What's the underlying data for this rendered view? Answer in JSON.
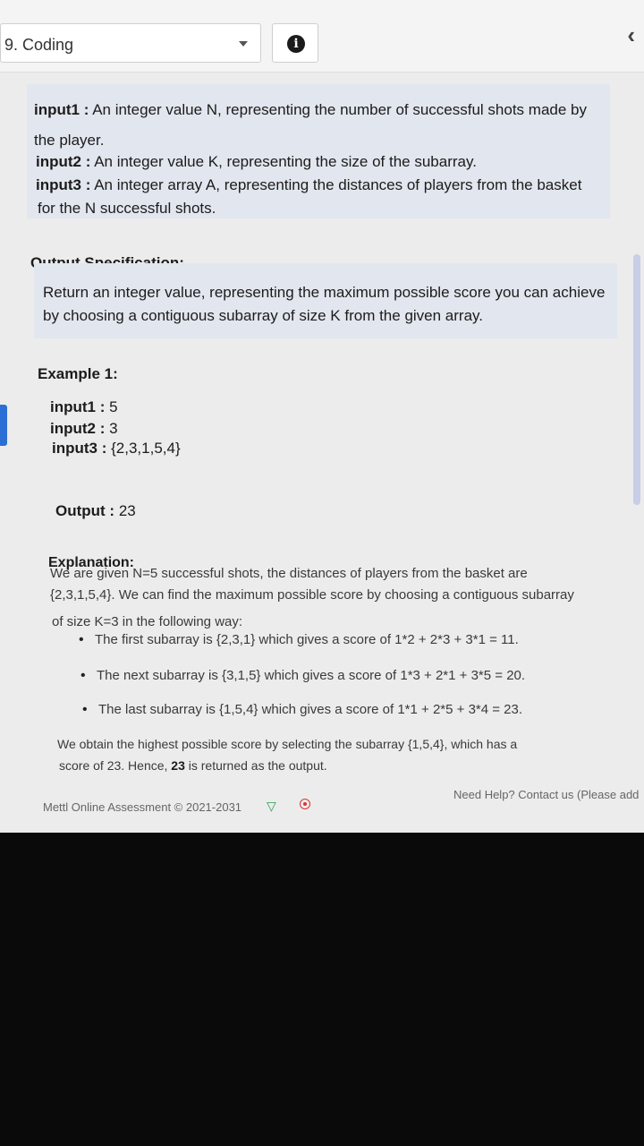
{
  "header": {
    "question_select": "9. Coding",
    "info_icon": "info-icon",
    "back_icon": "chevron-left-icon"
  },
  "input_spec": {
    "input1_label": "input1 :",
    "input1_text": "An integer value N, representing the number of successful shots made by",
    "input1_text_cont": "the player.",
    "input2_label": "input2 :",
    "input2_text": "An integer value K, representing the size of the subarray.",
    "input3_label": "input3 :",
    "input3_text": "An integer array A, representing the distances of players from the basket",
    "input3_text_cont": "for the N successful shots."
  },
  "output_spec": {
    "heading": "Output Specification:",
    "line1": "Return an integer value, representing the maximum possible score you can achieve",
    "line2": "by choosing a contiguous subarray of size K from the given array."
  },
  "example": {
    "heading": "Example 1:",
    "input1_label": "input1 :",
    "input1_value": "5",
    "input2_label": "input2 :",
    "input2_value": "3",
    "input3_label": "input3 :",
    "input3_value": "{2,3,1,5,4}",
    "output_label": "Output :",
    "output_value": "23"
  },
  "explanation": {
    "heading": "Explanation:",
    "line1": "We are given N=5 successful shots, the distances of players from the basket are",
    "line2": "{2,3,1,5,4}. We can find the maximum possible score by choosing a contiguous subarray",
    "line3": "of size K=3 in the following way:",
    "bullets": [
      "The first subarray is {2,3,1} which gives a score of 1*2 + 2*3 + 3*1 = 11.",
      "The next subarray is {3,1,5} which gives a score of 1*3 + 2*1 + 3*5 = 20.",
      "The last subarray is {1,5,4} which gives a score of 1*1 + 2*5 + 3*4 = 23."
    ],
    "conclusion_line1": "We obtain the highest possible score by selecting the subarray {1,5,4}, which has a",
    "conclusion_line2_a": "score of 23. Hence,",
    "conclusion_line2_b": "23",
    "conclusion_line2_c": "is returned as the output."
  },
  "footer": {
    "left": "Mettl Online Assessment © 2021-2031",
    "right": "Need Help? Contact us (Please add",
    "wifi_icon": "wifi-icon",
    "record_icon": "record-icon"
  }
}
